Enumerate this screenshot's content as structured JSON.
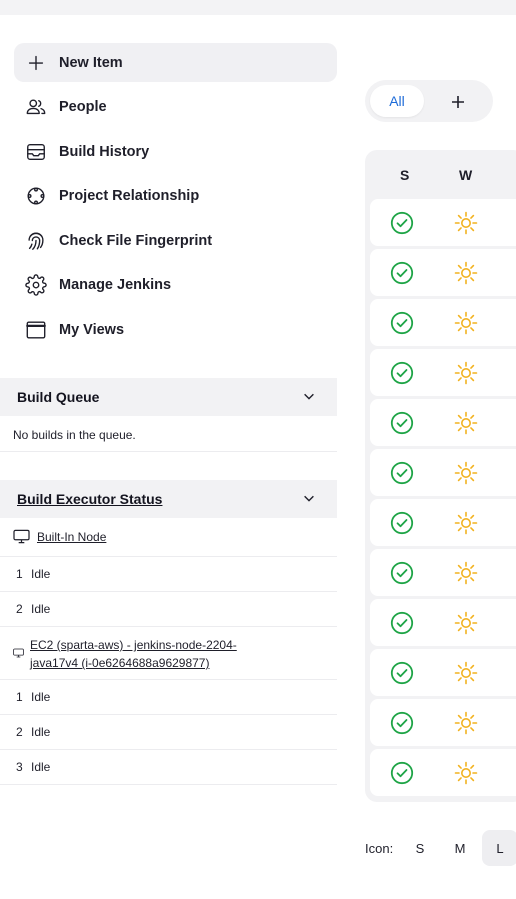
{
  "tasks": [
    {
      "label": "New Item",
      "icon": "plus-icon"
    },
    {
      "label": "People",
      "icon": "people-icon"
    },
    {
      "label": "Build History",
      "icon": "inbox-icon"
    },
    {
      "label": "Project Relationship",
      "icon": "relationship-icon"
    },
    {
      "label": "Check File Fingerprint",
      "icon": "fingerprint-icon"
    },
    {
      "label": "Manage Jenkins",
      "icon": "gear-icon"
    },
    {
      "label": "My Views",
      "icon": "window-icon"
    }
  ],
  "build_queue": {
    "title": "Build Queue",
    "empty_text": "No builds in the queue."
  },
  "executor_status": {
    "title": "Build Executor Status",
    "nodes": [
      {
        "name": "Built-In Node",
        "executors": [
          {
            "num": "1",
            "status": "Idle"
          },
          {
            "num": "2",
            "status": "Idle"
          }
        ]
      },
      {
        "name": "EC2 (sparta-aws) - jenkins-node-2204-java17v4 (i-0e6264688a9629877)",
        "name_line1": "EC2 (sparta-aws) - jenkins-node-2204-",
        "name_line2": "java17v4 (i-0e6264688a9629877)",
        "executors": [
          {
            "num": "1",
            "status": "Idle"
          },
          {
            "num": "2",
            "status": "Idle"
          },
          {
            "num": "3",
            "status": "Idle"
          }
        ]
      }
    ]
  },
  "views": {
    "tabs": [
      {
        "label": "All"
      }
    ],
    "add_label": "+"
  },
  "table": {
    "headers": {
      "status": "S",
      "weather": "W"
    },
    "rows": [
      {
        "status": "success",
        "weather": "sunny"
      },
      {
        "status": "success",
        "weather": "sunny"
      },
      {
        "status": "success",
        "weather": "sunny"
      },
      {
        "status": "success",
        "weather": "sunny"
      },
      {
        "status": "success",
        "weather": "sunny"
      },
      {
        "status": "success",
        "weather": "sunny"
      },
      {
        "status": "success",
        "weather": "sunny"
      },
      {
        "status": "success",
        "weather": "sunny"
      },
      {
        "status": "success",
        "weather": "sunny"
      },
      {
        "status": "success",
        "weather": "sunny"
      },
      {
        "status": "success",
        "weather": "sunny"
      },
      {
        "status": "success",
        "weather": "sunny"
      }
    ]
  },
  "icon_size": {
    "label": "Icon:",
    "options": [
      "S",
      "M",
      "L"
    ],
    "selected": "L"
  },
  "colors": {
    "accent": "#1d6bd8",
    "success": "#1ea446",
    "sunny": "#f2b21f"
  }
}
